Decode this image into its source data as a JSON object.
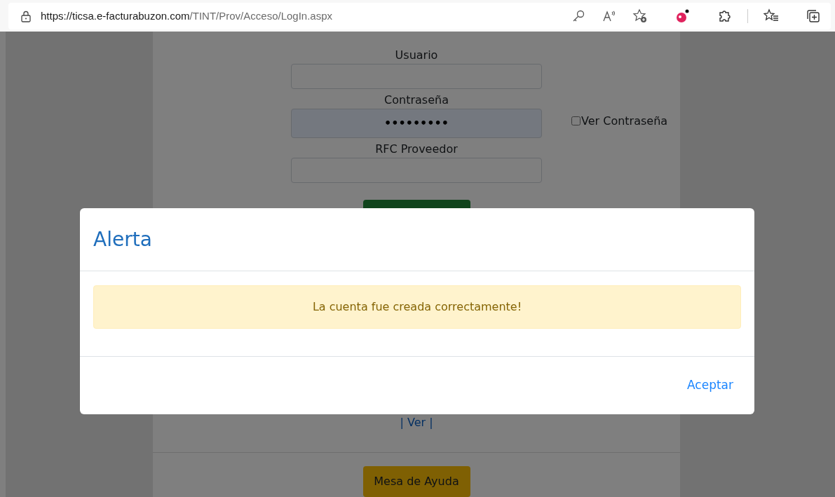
{
  "address_bar": {
    "url_host": "https://ticsa.e-facturabuzon.com",
    "url_path": "/TINT/Prov/Acceso/LogIn.aspx"
  },
  "login_form": {
    "fields": [
      {
        "label": "Usuario",
        "autofilled": false
      },
      {
        "label": "Contraseña",
        "value": "•••••••••",
        "autofilled": true
      },
      {
        "label": "RFC Proveedor",
        "autofilled": false
      }
    ],
    "show_password": {
      "label": "Ver Contraseña",
      "checked": false
    },
    "link": "| Ver |",
    "help_button": "Mesa de Ayuda"
  },
  "modal": {
    "title": "Alerta",
    "message": "La cuenta fue creada correctamente!",
    "button": "Aceptar"
  }
}
